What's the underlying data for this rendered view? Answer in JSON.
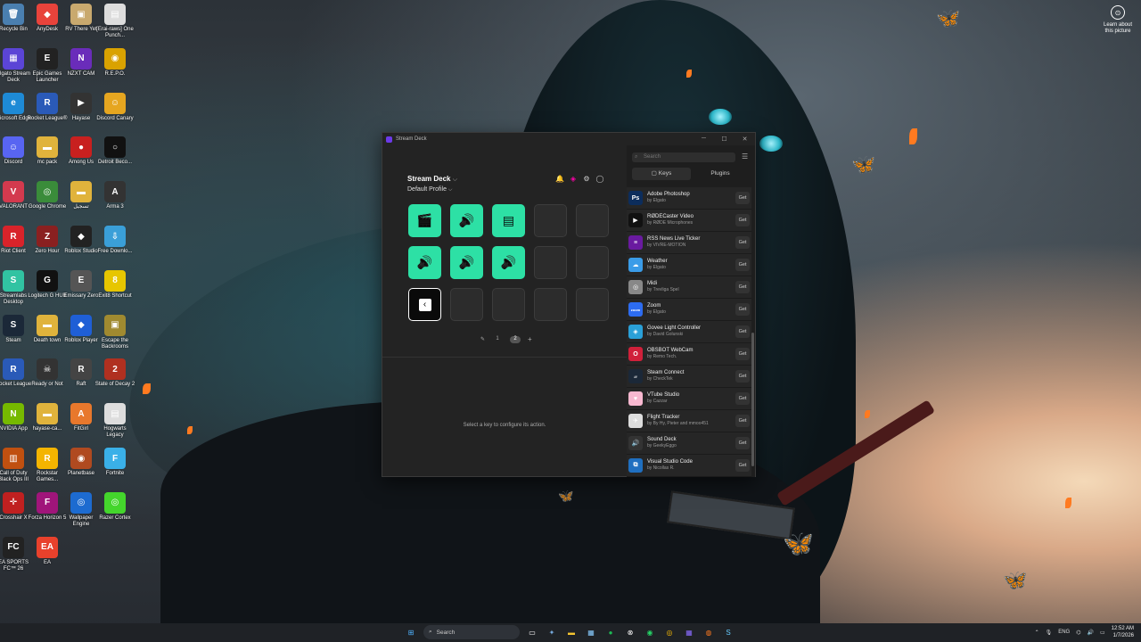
{
  "desktop": {
    "icons": [
      {
        "label": "Recycle Bin",
        "color": "#4a7fb0",
        "glyph": "🗑"
      },
      {
        "label": "AnyDesk",
        "color": "#e8433b",
        "glyph": "◆"
      },
      {
        "label": "RV There Yet",
        "color": "#c9a96e",
        "glyph": "▣"
      },
      {
        "label": "[Erai-raws] One Punch...",
        "color": "#ddd",
        "glyph": "▤"
      },
      {
        "label": "Elgato Stream Deck",
        "color": "#5b45d6",
        "glyph": "▦"
      },
      {
        "label": "Epic Games Launcher",
        "color": "#222",
        "glyph": "E"
      },
      {
        "label": "NZXT CAM",
        "color": "#6a2cba",
        "glyph": "N"
      },
      {
        "label": "R.E.P.O.",
        "color": "#d9a200",
        "glyph": "◉"
      },
      {
        "label": "Microsoft Edge",
        "color": "#1e8ad6",
        "glyph": "e"
      },
      {
        "label": "Rocket League®",
        "color": "#2a5ab8",
        "glyph": "R"
      },
      {
        "label": "Hayase",
        "color": "#333",
        "glyph": "▶"
      },
      {
        "label": "Discord Canary",
        "color": "#e6a620",
        "glyph": "☺"
      },
      {
        "label": "Discord",
        "color": "#5865f2",
        "glyph": "☺"
      },
      {
        "label": "mc pack",
        "color": "#e0b33c",
        "glyph": "▬"
      },
      {
        "label": "Among Us",
        "color": "#c8201f",
        "glyph": "●"
      },
      {
        "label": "Detroit Beco...",
        "color": "#111",
        "glyph": "○"
      },
      {
        "label": "VALORANT",
        "color": "#d33a4e",
        "glyph": "V"
      },
      {
        "label": "Google Chrome",
        "color": "#3a8c3a",
        "glyph": "◎"
      },
      {
        "label": "تسجيل",
        "color": "#e0b33c",
        "glyph": "▬"
      },
      {
        "label": "Arma 3",
        "color": "#333",
        "glyph": "A"
      },
      {
        "label": "Riot Client",
        "color": "#d8232a",
        "glyph": "R"
      },
      {
        "label": "Zero Hour",
        "color": "#8a2020",
        "glyph": "Z"
      },
      {
        "label": "Roblox Studio",
        "color": "#222",
        "glyph": "◆"
      },
      {
        "label": "Free Downlo...",
        "color": "#3a9fd8",
        "glyph": "⇩"
      },
      {
        "label": "Streamlabs Desktop",
        "color": "#31c3a2",
        "glyph": "S"
      },
      {
        "label": "Logitech G HUB",
        "color": "#111",
        "glyph": "G"
      },
      {
        "label": "Emissary Zero",
        "color": "#555",
        "glyph": "E"
      },
      {
        "label": "Exit8 Shortcut",
        "color": "#e7c600",
        "glyph": "8"
      },
      {
        "label": "Steam",
        "color": "#1b2838",
        "glyph": "S"
      },
      {
        "label": "Death town",
        "color": "#e0b33c",
        "glyph": "▬"
      },
      {
        "label": "Roblox Player",
        "color": "#1f5fd6",
        "glyph": "◆"
      },
      {
        "label": "Escape the Backrooms",
        "color": "#a08a30",
        "glyph": "▣"
      },
      {
        "label": "Rocket League",
        "color": "#2a5ab8",
        "glyph": "R"
      },
      {
        "label": "Ready or Not",
        "color": "#333",
        "glyph": "☠"
      },
      {
        "label": "Raft",
        "color": "#444",
        "glyph": "R"
      },
      {
        "label": "State of Decay 2",
        "color": "#b03020",
        "glyph": "2"
      },
      {
        "label": "NVIDIA App",
        "color": "#76b900",
        "glyph": "N"
      },
      {
        "label": "hayase-ca...",
        "color": "#e0b33c",
        "glyph": "▬"
      },
      {
        "label": "FitGirl",
        "color": "#e8782c",
        "glyph": "A"
      },
      {
        "label": "Hogwarts Legacy",
        "color": "#ddd",
        "glyph": "▤"
      },
      {
        "label": "Call of Duty Black Ops III",
        "color": "#c05010",
        "glyph": "▥"
      },
      {
        "label": "Rockstar Games...",
        "color": "#f4b400",
        "glyph": "R"
      },
      {
        "label": "Planetbase",
        "color": "#b04a20",
        "glyph": "◉"
      },
      {
        "label": "Fortnite",
        "color": "#3ab0e8",
        "glyph": "F"
      },
      {
        "label": "Crosshair X",
        "color": "#c02020",
        "glyph": "✛"
      },
      {
        "label": "Forza Horizon 5",
        "color": "#a0157a",
        "glyph": "F"
      },
      {
        "label": "Wallpaper Engine",
        "color": "#1d6bd0",
        "glyph": "◎"
      },
      {
        "label": "Razer Cortex",
        "color": "#44d62c",
        "glyph": "◎"
      },
      {
        "label": "EA SPORTS FC™ 26",
        "color": "#222",
        "glyph": "FC"
      },
      {
        "label": "EA",
        "color": "#e8412c",
        "glyph": "EA"
      }
    ],
    "learn_about": "Learn about this picture"
  },
  "window": {
    "title": "Stream Deck",
    "controls": [
      "─",
      "☐",
      "✕"
    ],
    "device_name": "Stream Deck",
    "profile": "Default Profile",
    "keys": [
      {
        "type": "green",
        "glyph": "🎬"
      },
      {
        "type": "green",
        "glyph": "🔊"
      },
      {
        "type": "green",
        "glyph": "▤"
      },
      {
        "type": "empty",
        "glyph": ""
      },
      {
        "type": "empty",
        "glyph": ""
      },
      {
        "type": "green",
        "glyph": "🔊"
      },
      {
        "type": "green",
        "glyph": "🔊"
      },
      {
        "type": "green",
        "glyph": "🔊"
      },
      {
        "type": "empty",
        "glyph": ""
      },
      {
        "type": "empty",
        "glyph": ""
      },
      {
        "type": "back",
        "glyph": "‹"
      },
      {
        "type": "empty",
        "glyph": ""
      },
      {
        "type": "empty",
        "glyph": ""
      },
      {
        "type": "empty",
        "glyph": ""
      },
      {
        "type": "empty",
        "glyph": ""
      }
    ],
    "pages": [
      "1",
      "2"
    ],
    "current_page": "2",
    "hint": "Select a key to configure its action.",
    "search_placeholder": "Search",
    "tabs": {
      "keys": "Keys",
      "plugins": "Plugins"
    },
    "get_label": "Get",
    "plugins": [
      {
        "name": "Adobe Photoshop",
        "by": "by Elgato",
        "color": "#0c2d5c",
        "glyph": "Ps"
      },
      {
        "name": "RØDECaster Video",
        "by": "by RØDE Microphones",
        "color": "#111",
        "glyph": "▶"
      },
      {
        "name": "RSS News Live Ticker",
        "by": "by VIVRE-MOTION",
        "color": "#6a1aa0",
        "glyph": "≡"
      },
      {
        "name": "Weather",
        "by": "by Elgato",
        "color": "#3a9ce8",
        "glyph": "☁"
      },
      {
        "name": "Midi",
        "by": "by Trevliga Spel",
        "color": "#888",
        "glyph": "◎"
      },
      {
        "name": "Zoom",
        "by": "by Elgato",
        "color": "#2d6cf0",
        "glyph": "zoom"
      },
      {
        "name": "Govee Light Controller",
        "by": "by David Golunski",
        "color": "#2aa0d8",
        "glyph": "◈"
      },
      {
        "name": "OBSBOT WebCam",
        "by": "by Remo Tech.",
        "color": "#d0203a",
        "glyph": "O"
      },
      {
        "name": "Steam Connect",
        "by": "by CheckTek",
        "color": "#1b2838",
        "glyph": "///"
      },
      {
        "name": "VTube Studio",
        "by": "by Cazzar",
        "color": "#f8b8d0",
        "glyph": "♥"
      },
      {
        "name": "Flight Tracker",
        "by": "by By Hy, Pieter and mmoo451",
        "color": "#ddd",
        "glyph": "✈"
      },
      {
        "name": "Sound Deck",
        "by": "by GeekyEggo",
        "color": "#333",
        "glyph": "🔊"
      },
      {
        "name": "Visual Studio Code",
        "by": "by Nicollas R.",
        "color": "#1f6fc0",
        "glyph": "⧉"
      }
    ]
  },
  "taskbar": {
    "search_label": "Search",
    "lang": "ENG",
    "time": "12:52 AM",
    "date": "1/7/2026"
  }
}
